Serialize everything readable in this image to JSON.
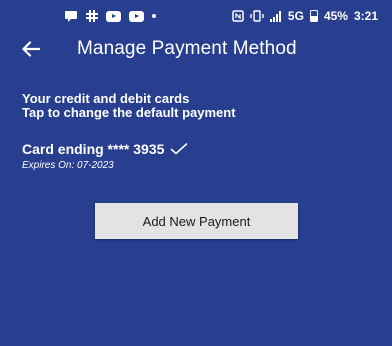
{
  "status_bar": {
    "network": "5G",
    "battery": "45%",
    "time": "3:21"
  },
  "app_bar": {
    "title": "Manage Payment Method"
  },
  "info": {
    "line1": "Your credit and debit cards",
    "line2": "Tap to change the default payment"
  },
  "card": {
    "label": "Card ending **** 3935",
    "expiry": "Expires On: 07-2023",
    "is_default": true
  },
  "add_button": {
    "label": "Add New Payment"
  },
  "colors": {
    "background": "#283e8f",
    "button_bg": "#e3e3e3",
    "text": "#ffffff"
  }
}
